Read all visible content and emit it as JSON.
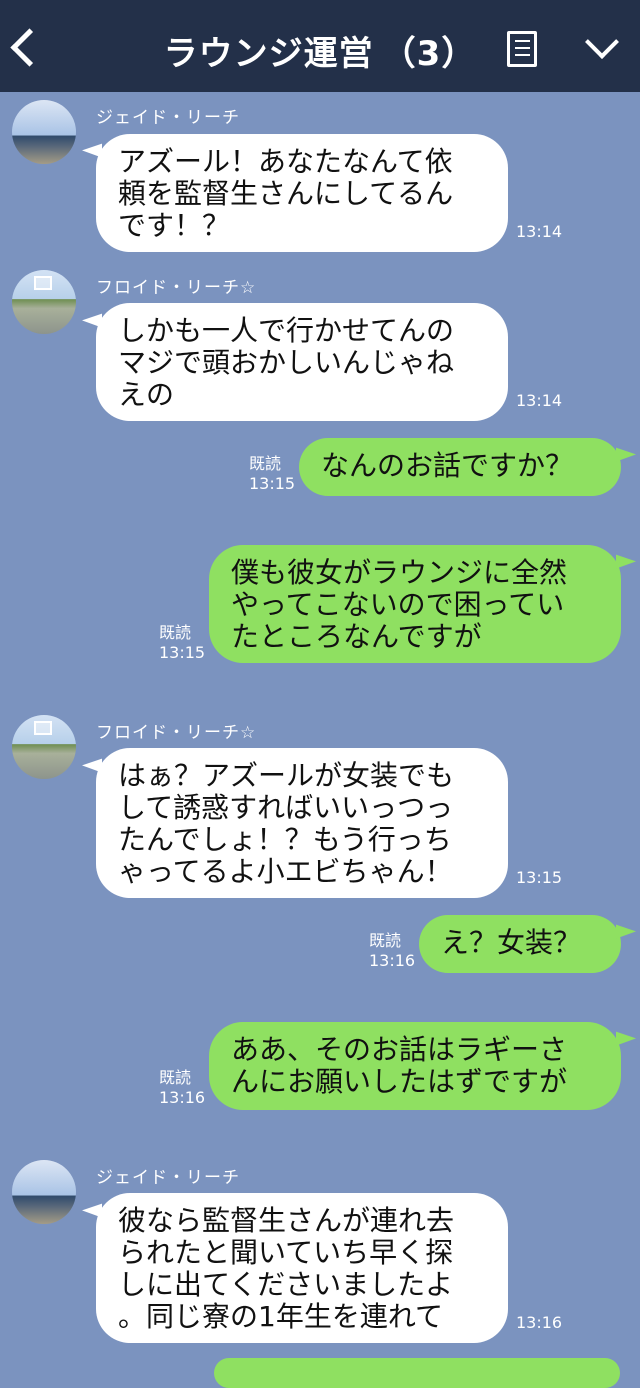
{
  "header": {
    "title": "ラウンジ運営",
    "count": "（3）",
    "back_icon": "chevron-left-icon",
    "notes_icon": "notes-icon",
    "menu_icon": "chevron-down-icon"
  },
  "colors": {
    "background": "#7b93bf",
    "header": "#233049",
    "outgoing_bubble": "#8fe061",
    "incoming_bubble": "#ffffff"
  },
  "messages": [
    {
      "sender": "ジェイド・リーチ",
      "text": "アズール！あなたなんて依\n頼を監督生さんにしてるん\nです！？",
      "time": "13:14"
    },
    {
      "sender": "フロイド・リーチ☆",
      "text": "しかも一人で行かせてんの\nマジで頭おかしいんじゃね\nえの",
      "time": "13:14"
    },
    {
      "read": "既読",
      "text": "なんのお話ですか？",
      "time": "13:15"
    },
    {
      "read": "既読",
      "text": "僕も彼女がラウンジに全然\nやってこないので困ってい\nたところなんですが",
      "time": "13:15"
    },
    {
      "sender": "フロイド・リーチ☆",
      "text": "はぁ？アズールが女装でも\nして誘惑すればいいっつっ\nたんでしょ！？もう行っち\nゃってるよ小エビちゃん！",
      "time": "13:15"
    },
    {
      "read": "既読",
      "text": "え？女装？",
      "time": "13:16"
    },
    {
      "read": "既読",
      "text": "ああ、そのお話はラギーさ\nんにお願いしたはずですが",
      "time": "13:16"
    },
    {
      "sender": "ジェイド・リーチ",
      "text": "彼なら監督生さんが連れ去\nられたと聞いていち早く探\nしに出てくださいましたよ\n。同じ寮の1年生を連れて",
      "time": "13:16"
    }
  ]
}
